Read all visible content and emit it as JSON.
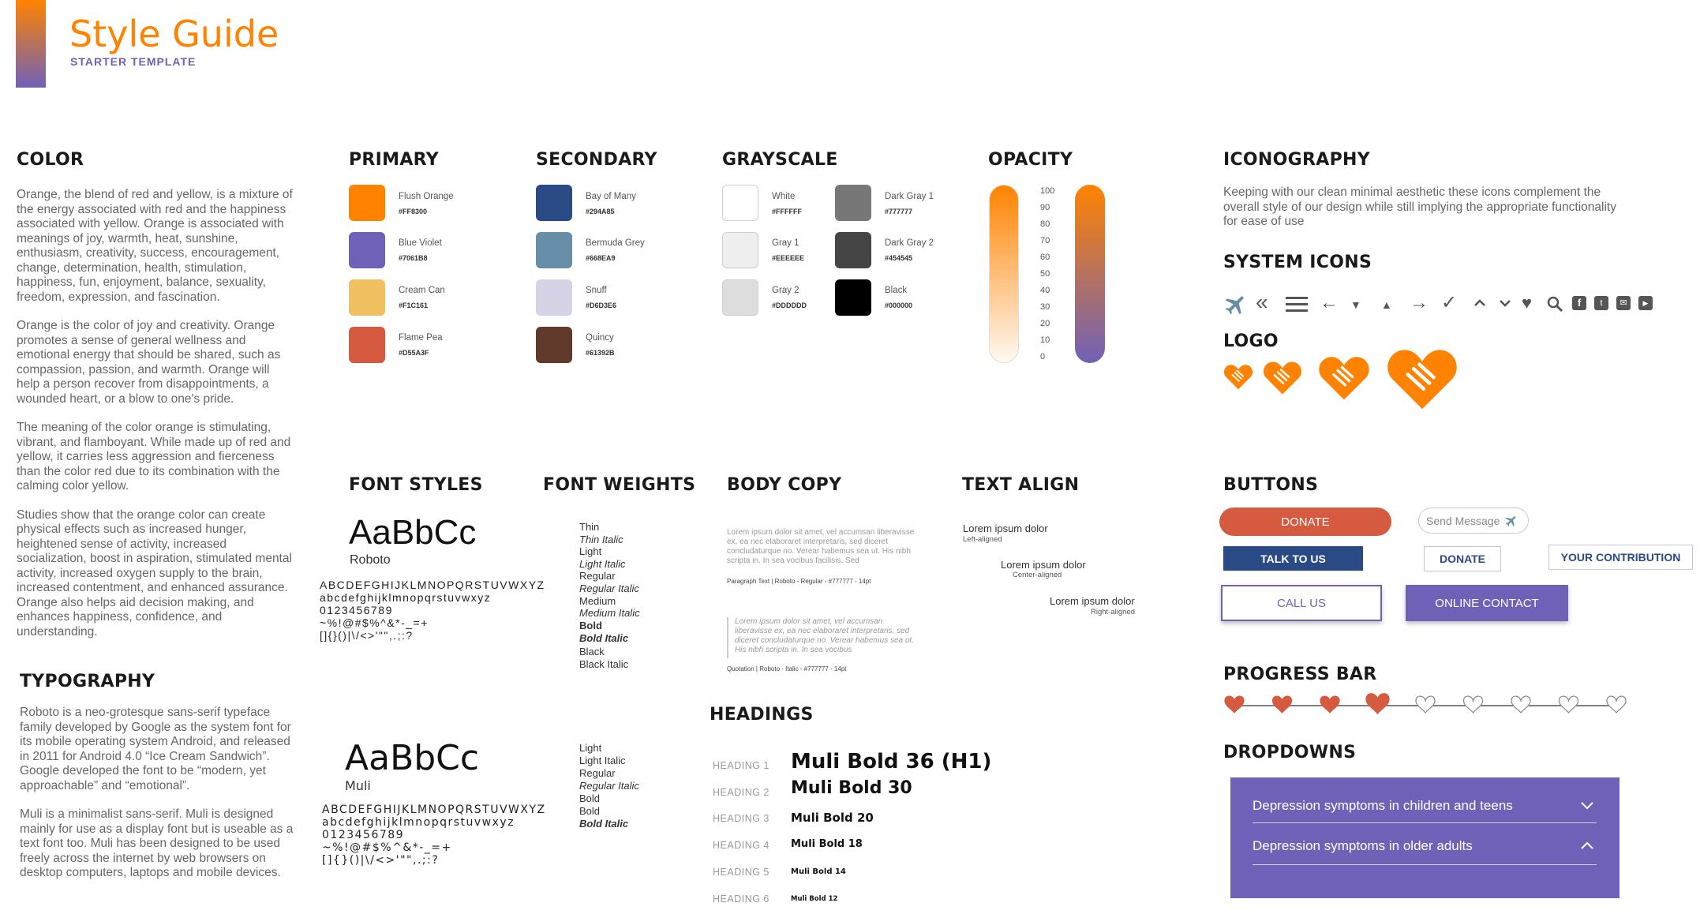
{
  "header": {
    "title": "Style Guide",
    "subtitle": "STARTER TEMPLATE"
  },
  "color_section": {
    "title": "COLOR",
    "paragraphs": [
      "Orange, the blend of red and yellow, is a mixture of the energy associated with red and the happiness associated with yellow. Orange is associated with meanings of joy, warmth, heat, sunshine, enthusiasm, creativity, success, encouragement, change, determination, health, stimulation, happiness, fun, enjoyment, balance, sexuality, freedom, expression, and fascination.",
      "Orange is the color of joy and creativity. Orange promotes a sense of general wellness and emotional energy that should be shared, such as compassion, passion, and warmth. Orange will help a person recover from disappointments, a wounded heart, or a blow to one's pride.",
      "The meaning of the color orange is stimulating, vibrant, and flamboyant. While made up of red and yellow, it carries less aggression and fierceness than the color red due to its combination with the calming color yellow.",
      "Studies show that the orange color can create physical effects such as increased hunger, heightened sense of activity, increased socialization, boost in aspiration, stimulated mental activity, increased oxygen supply to the brain, increased contentment, and enhanced assurance. Orange also helps aid decision making, and enhances happiness, confidence, and understanding."
    ]
  },
  "typography_section": {
    "title": "TYPOGRAPHY",
    "paragraphs": [
      "Roboto is a neo-grotesque sans-serif typeface family developed by Google as the system font for its mobile operating system Android, and released in 2011 for Android 4.0 “Ice Cream Sandwich”. Google developed the font to be “modern, yet approachable” and “emotional”.",
      "Muli is a minimalist sans-serif. Muli is designed mainly for use as a display font but is useable as a text font too. Muli has been designed to be used freely across the internet by web browsers on desktop computers, laptops and mobile devices."
    ]
  },
  "primary": {
    "title": "PRIMARY",
    "swatches": [
      {
        "name": "Flush Orange",
        "hex": "#FF8300",
        "color": "#FF8300"
      },
      {
        "name": "Blue Violet",
        "hex": "#7061B8",
        "color": "#7061B8"
      },
      {
        "name": "Cream Can",
        "hex": "#F1C161",
        "color": "#F1C161"
      },
      {
        "name": "Flame Pea",
        "hex": "#D55A3F",
        "color": "#D55A3F"
      }
    ]
  },
  "secondary": {
    "title": "SECONDARY",
    "swatches": [
      {
        "name": "Bay of Many",
        "hex": "#294A85",
        "color": "#294A85"
      },
      {
        "name": "Bermuda Grey",
        "hex": "#668EA9",
        "color": "#668EA9"
      },
      {
        "name": "Snuff",
        "hex": "#D6D3E6",
        "color": "#D6D3E6"
      },
      {
        "name": "Quincy",
        "hex": "#61392B",
        "color": "#61392B"
      }
    ]
  },
  "grayscale": {
    "title": "GRAYSCALE",
    "swatches": [
      {
        "name": "White",
        "hex": "#FFFFFF",
        "color": "#FFFFFF"
      },
      {
        "name": "Gray 1",
        "hex": "#EEEEEE",
        "color": "#EEEEEE"
      },
      {
        "name": "Gray 2",
        "hex": "#DDDDDD",
        "color": "#DDDDDD"
      },
      {
        "name": "Dark Gray 1",
        "hex": "#777777",
        "color": "#777777"
      },
      {
        "name": "Dark Gray 2",
        "hex": "#454545",
        "color": "#454545"
      },
      {
        "name": "Black",
        "hex": "#000000",
        "color": "#000000"
      }
    ]
  },
  "opacity": {
    "title": "OPACITY",
    "ticks": [
      "100",
      "90",
      "80",
      "70",
      "60",
      "50",
      "40",
      "30",
      "20",
      "10",
      "0"
    ]
  },
  "iconography": {
    "title": "ICONOGRAPHY",
    "description": "Keeping with our clean minimal aesthetic these icons complement the overall style of our design while still implying the appropriate functionality for ease of use",
    "system_icons_title": "SYSTEM ICONS",
    "icons": [
      "plane-icon",
      "double-chevron-left-icon",
      "hamburger-menu-icon",
      "arrow-left-icon",
      "caret-down-icon",
      "caret-up-icon",
      "arrow-right-icon",
      "checkmark-icon",
      "chevron-up-icon",
      "chevron-down-icon",
      "heart-icon",
      "search-icon",
      "facebook-icon",
      "twitter-icon",
      "email-icon",
      "youtube-icon"
    ],
    "logo_title": "LOGO"
  },
  "font_styles": {
    "title": "FONT STYLES",
    "roboto_sample": "AaBbCc",
    "roboto_name": "Roboto",
    "roboto_chars": "ABCDEFGHIJKLMNOPQRSTUVWXYZ\nabcdefghijklmnopqrstuvwxyz\n0123456789\n~%!@#$%^&*-_=+\n[]{}()|\\/<>'\"\",.;:?",
    "muli_sample": "AaBbCc",
    "muli_name": "Muli",
    "muli_chars": "ABCDEFGHIJKLMNOPQRSTUVWXYZ\nabcdefghijklmnopqrstuvwxyz\n0123456789\n~%!@#$%^&*-_=+\n[]{}()|\\/<>'\"\",.;:?"
  },
  "font_weights": {
    "title": "FONT WEIGHTS",
    "roboto": [
      "Thin",
      "Thin Italic",
      "Light",
      "Light Italic",
      "Regular",
      "Regular Italic",
      "Medium",
      "Medium Italic",
      "Bold",
      "Bold Italic",
      "Black",
      "Black Italic"
    ],
    "muli": [
      "Light",
      "Light Italic",
      "Regular",
      "Regular Italic",
      "Bold",
      "Bold",
      "Bold Italic"
    ]
  },
  "body_copy": {
    "title": "BODY COPY",
    "paragraph_sample": "Lorem ipsum dolor sit amet, vel accumsan liberavisse ex, ea nec elaboraret interpretaris, sed diceret concludaturque no. Verear habemus sea ut. His nibh scripta in. In sea vocibus facilisis. Sed",
    "paragraph_caption": "Paragraph Text | Roboto - Regular - #777777 - 14pt",
    "quote_sample": "Lorem ipsum dolor sit amet, vel accumsan liberavisse ex, ea nec elaboraret interpretaris, sed diceret concludaturque no. Verear habemus sea ut. His nibh scripta in. In sea vocibus",
    "quote_caption": "Quotation | Roboto - Italic - #777777 - 14pt"
  },
  "text_align": {
    "title": "TEXT ALIGN",
    "items": [
      {
        "text": "Lorem ipsum dolor",
        "caption": "Left-aligned"
      },
      {
        "text": "Lorem ipsum dolor",
        "caption": "Center-aligned"
      },
      {
        "text": "Lorem ipsum dolor",
        "caption": "Right-aligned"
      }
    ]
  },
  "headings": {
    "title": "HEADINGS",
    "items": [
      {
        "label": "HEADING 1",
        "sample": "Muli Bold 36 (H1)"
      },
      {
        "label": "HEADING 2",
        "sample": "Muli Bold 30"
      },
      {
        "label": "HEADING 3",
        "sample": "Muli Bold 20"
      },
      {
        "label": "HEADING 4",
        "sample": "Muli Bold 18"
      },
      {
        "label": "HEADING 5",
        "sample": "Muli Bold 14"
      },
      {
        "label": "HEADING 6",
        "sample": "Muli Bold 12"
      }
    ]
  },
  "buttons": {
    "title": "BUTTONS",
    "donate_primary": "DONATE",
    "send_message": "Send Message",
    "talk_to_us": "TALK TO US",
    "donate_outline": "DONATE",
    "your_contribution": "YOUR CONTRIBUTION",
    "call_us": "CALL US",
    "online_contact": "ONLINE CONTACT"
  },
  "progress_bar": {
    "title": "PROGRESS BAR",
    "total_steps": 9,
    "completed_steps": 4,
    "current_step": 4
  },
  "dropdowns": {
    "title": "DROPDOWNS",
    "items": [
      {
        "label": "Depression symptoms in children and teens",
        "state": "collapsed"
      },
      {
        "label": "Depression symptoms in older adults",
        "state": "expanded"
      }
    ]
  },
  "colors": {
    "accent": "#FF8300",
    "violet": "#7061B8",
    "flame": "#D55A3F",
    "navy": "#294A85"
  }
}
